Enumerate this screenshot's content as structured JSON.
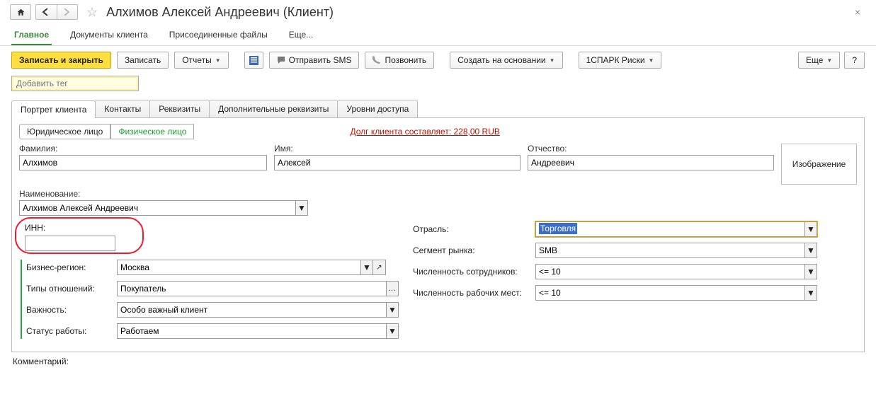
{
  "header": {
    "title": "Алхимов Алексей Андреевич (Клиент)"
  },
  "nav_tabs": {
    "main": "Главное",
    "docs": "Документы клиента",
    "files": "Присоединенные файлы",
    "more": "Еще..."
  },
  "toolbar": {
    "save_close": "Записать и закрыть",
    "save": "Записать",
    "reports": "Отчеты",
    "send_sms": "Отправить SMS",
    "call": "Позвонить",
    "create_based": "Создать на основании",
    "spark": "1СПАРК Риски",
    "more": "Еще",
    "help": "?"
  },
  "tag": {
    "placeholder": "Добавить тег"
  },
  "inner_tabs": {
    "portrait": "Портрет клиента",
    "contacts": "Контакты",
    "requisites": "Реквизиты",
    "extra": "Дополнительные реквизиты",
    "access": "Уровни доступа"
  },
  "type_toggle": {
    "legal": "Юридическое лицо",
    "individual": "Физическое лицо"
  },
  "debt": "Долг клиента составляет: 228,00 RUB",
  "person": {
    "last_name_label": "Фамилия:",
    "last_name": "Алхимов",
    "first_name_label": "Имя:",
    "first_name": "Алексей",
    "middle_name_label": "Отчество:",
    "middle_name": "Андреевич",
    "image_label": "Изображение"
  },
  "naming": {
    "label": "Наименование:",
    "value": "Алхимов Алексей Андреевич"
  },
  "left": {
    "inn_label": "ИНН:",
    "inn_value": "",
    "region_label": "Бизнес-регион:",
    "region_value": "Москва",
    "relation_label": "Типы отношений:",
    "relation_value": "Покупатель",
    "importance_label": "Важность:",
    "importance_value": "Особо важный клиент",
    "status_label": "Статус работы:",
    "status_value": "Работаем"
  },
  "right": {
    "industry_label": "Отрасль:",
    "industry_value": "Торговля",
    "segment_label": "Сегмент рынка:",
    "segment_value": "SMB",
    "staff_label": "Численность сотрудников:",
    "staff_value": "<= 10",
    "places_label": "Численность рабочих мест:",
    "places_value": "<= 10"
  },
  "comment_label": "Комментарий:"
}
